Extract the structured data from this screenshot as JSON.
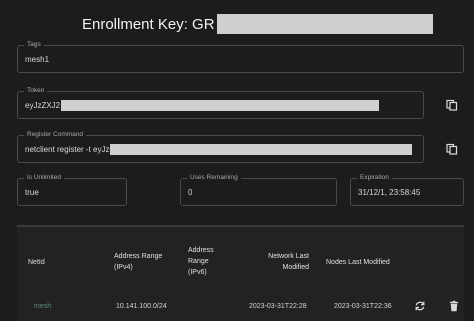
{
  "title": {
    "prefix": "Enrollment Key: GR"
  },
  "tags": {
    "label": "Tags",
    "value": "mesh1"
  },
  "token": {
    "label": "Token",
    "value": "eyJzZXJ2"
  },
  "register_command": {
    "label": "Register Command",
    "value": "netclient register -t eyJz"
  },
  "is_unlimited": {
    "label": "Is Unlimited",
    "value": "true"
  },
  "uses_remaining": {
    "label": "Uses Remaining",
    "value": "0"
  },
  "expiration": {
    "label": "Expiration",
    "value": "31/12/1, 23:58:45"
  },
  "table": {
    "headers": {
      "netid": "NetId",
      "ipv4_line1": "Address Range",
      "ipv4_line2": "(IPv4)",
      "ipv6_line1": "Address",
      "ipv6_line2": "Range",
      "ipv6_line3": "(IPv6)",
      "modified_line1": "Network Last",
      "modified_line2": "Modified",
      "nodes_modified": "Nodes Last Modified"
    },
    "rows": [
      {
        "netid": "mesh",
        "ipv4": "10.141.100.0/24",
        "ipv6": "",
        "network_last_modified": "2023-03-31T22:28",
        "nodes_last_modified": "2023-03-31T22:36"
      }
    ]
  },
  "icons": {
    "copy": "copy-icon",
    "refresh": "refresh-icon",
    "delete": "delete-icon"
  }
}
